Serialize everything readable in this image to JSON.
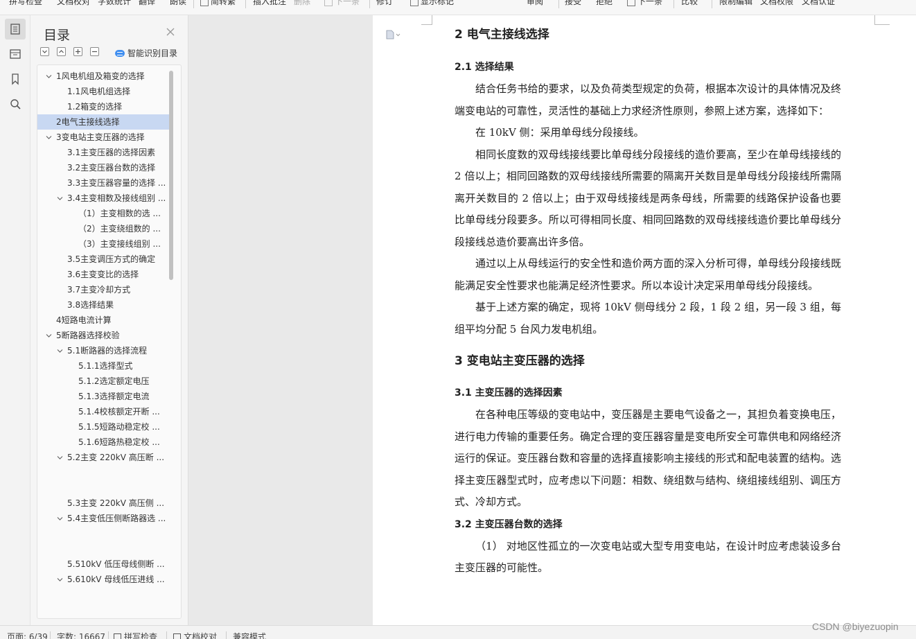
{
  "ribbon": {
    "items": [
      "拼写检查",
      "文档校对",
      "字数统计",
      "翻译",
      "朗读",
      "简转繁",
      "插入批注",
      "删除",
      "下一条",
      "修订",
      "显示标记",
      "审阅",
      "接受",
      "拒绝",
      "下一条",
      "比较",
      "限制编辑",
      "文档权限",
      "文档认证"
    ]
  },
  "iconbar": {
    "icons": [
      "toc-icon",
      "navigation-icon",
      "bookmark-icon",
      "search-icon"
    ]
  },
  "toc": {
    "title": "目录",
    "smart_label": "智能识别目录",
    "items": [
      {
        "label": "1风电机组及箱变的选择",
        "level": 0,
        "expand": true
      },
      {
        "label": "1.1风电机组选择",
        "level": 1,
        "expand": false
      },
      {
        "label": "1.2箱变的选择",
        "level": 1,
        "expand": false
      },
      {
        "label": "2电气主接线选择",
        "level": 0,
        "expand": false,
        "selected": true
      },
      {
        "label": "3变电站主变压器的选择",
        "level": 0,
        "expand": true
      },
      {
        "label": "3.1主变压器的选择因素",
        "level": 1,
        "expand": false
      },
      {
        "label": "3.2主变压器台数的选择",
        "level": 1,
        "expand": false
      },
      {
        "label": "3.3主变压器容量的选择 ...",
        "level": 1,
        "expand": false
      },
      {
        "label": "3.4主变相数及接线组别 ...",
        "level": 1,
        "expand": true
      },
      {
        "label": "（1）主变相数的选 ...",
        "level": 2,
        "expand": false
      },
      {
        "label": "（2）主变绕组数的 ...",
        "level": 2,
        "expand": false
      },
      {
        "label": "（3）主变接线组别 ...",
        "level": 2,
        "expand": false
      },
      {
        "label": "3.5主变调压方式的确定",
        "level": 1,
        "expand": false
      },
      {
        "label": "3.6主变变比的选择",
        "level": 1,
        "expand": false
      },
      {
        "label": "3.7主变冷却方式",
        "level": 1,
        "expand": false
      },
      {
        "label": "3.8选择结果",
        "level": 1,
        "expand": false
      },
      {
        "label": "4短路电流计算",
        "level": 0,
        "expand": false
      },
      {
        "label": "5断路器选择校验",
        "level": 0,
        "expand": true
      },
      {
        "label": "5.1断路器的选择流程",
        "level": 1,
        "expand": true
      },
      {
        "label": "5.1.1选择型式",
        "level": 2,
        "expand": false
      },
      {
        "label": "5.1.2选定额定电压",
        "level": 2,
        "expand": false
      },
      {
        "label": "5.1.3选择额定电流",
        "level": 2,
        "expand": false
      },
      {
        "label": "5.1.4校核额定开断 ...",
        "level": 2,
        "expand": false
      },
      {
        "label": "5.1.5短路动稳定校 ...",
        "level": 2,
        "expand": false
      },
      {
        "label": "5.1.6短路热稳定校 ...",
        "level": 2,
        "expand": false
      },
      {
        "label": "5.2主变 220kV 高压断 ...",
        "level": 1,
        "expand": true
      },
      {
        "label": "5.3主变 220kV 高压侧 ...",
        "level": 1,
        "expand": false
      },
      {
        "label": "5.4主变低压侧断路器选 ...",
        "level": 1,
        "expand": true
      },
      {
        "label": "5.510kV 低压母线侧断 ...",
        "level": 1,
        "expand": false
      },
      {
        "label": "5.610kV 母线低压进线 ...",
        "level": 1,
        "expand": true
      }
    ]
  },
  "document": {
    "h2_1": "2  电气主接线选择",
    "h3_1": "2.1  选择结果",
    "p1": "结合任务书给的要求，以及负荷类型规定的负荷，根据本次设计的具体情况及终端变电站的可靠性，灵活性的基础上力求经济性原则，参照上述方案，选择如下：",
    "p2": "在 10kV 侧：采用单母线分段接线。",
    "p3a": "相同长度数的双母线接线要比单母线分段接线的造价要高，至少在单母线接线的 2 倍以上；相同回路数的双母线接线所需要的隔离开关数目是单母线分段接",
    "p3b": "线所需隔离开关数目的  2 倍以上；由于双母线接线是两条母线，所需要的线路保护设备也要比单母线分段要多。所以可得相同长度、相同回路数的双母线接线造价要比单母线分段接线总造价要高出许多倍。",
    "p4": "通过以上从母线运行的安全性和造价两方面的深入分析可得，单母线分段接线既能满足安全性要求也能满足经济性要求。所以本设计决定采用单母线分段接线。",
    "p5": "基于上述方案的确定，现将 10kV 侧母线分 2 段，1 段 2 组，另一段 3 组，每组平均分配 5 台风力发电机组。",
    "h2_2": "3  变电站主变压器的选择",
    "h3_2": "3.1  主变压器的选择因素",
    "p6": "在各种电压等级的变电站中，变压器是主要电气设备之一，其担负着变换电压，进行电力传输的重要任务。确定合理的变压器容量是变电所安全可靠供电和网络经济运行的保证。变压器台数和容量的选择直接影响主接线的形式和配电装置的结构。选择主变压器型式时，应考虑以下问题：相数、绕组数与结构、绕组接线组别、调压方式、冷却方式。",
    "h3_3": "3.2  主变压器台数的选择",
    "p7": "（1） 对地区性孤立的一次变电站或大型专用变电站，在设计时应考虑装设多台主变压器的可能性。"
  },
  "status": {
    "page": "页面: 6/39",
    "words": "字数: 16667",
    "spell": "拼写检查",
    "proof": "文档校对",
    "compat": "兼容模式"
  },
  "watermark": "CSDN @biyezuopin"
}
